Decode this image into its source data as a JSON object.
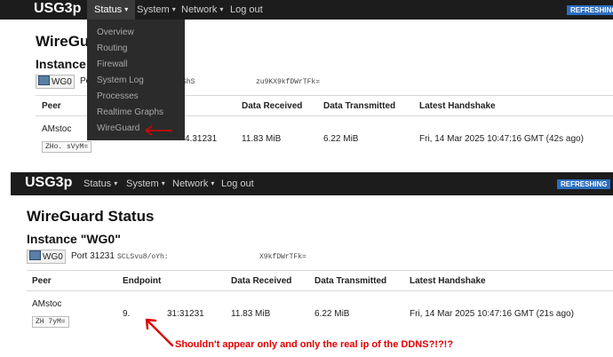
{
  "top_panel": {
    "brand": "USG3p",
    "nav": [
      "Status",
      "System",
      "Network",
      "Log out"
    ],
    "refresh_label": "REFRESHING",
    "dropdown_items": [
      "Overview",
      "Routing",
      "Firewall",
      "System Log",
      "Processes",
      "Realtime Graphs",
      "WireGuard"
    ],
    "page_title_partial": "WireGu",
    "instance_partial": "Instance \"",
    "interface_badge": "WG0",
    "port_partial": "Port",
    "key_partial_a": "ShS",
    "key_partial_b": "zu9KX9kfDWrTFk=",
    "headers": {
      "peer": "Peer",
      "data_received": "Data Received",
      "data_transmitted": "Data Transmitted",
      "latest_handshake": "Latest Handshake"
    },
    "row": {
      "peer_name": "AMstoc",
      "peer_key": "ZHo.    sVyM=",
      "endpoint_partial": "4.31231",
      "data_received": "11.83 MiB",
      "data_transmitted": "6.22 MiB",
      "latest_handshake": "Fri, 14 Mar 2025 10:47:16 GMT (42s ago)"
    }
  },
  "bottom_panel": {
    "brand": "USG3p",
    "nav": [
      "Status",
      "System",
      "Network",
      "Log out"
    ],
    "refresh_label": "REFRESHING",
    "page_title": "WireGuard Status",
    "instance_title": "Instance \"WG0\"",
    "interface_badge": "WG0",
    "port": "Port 31231",
    "key_partial_a": "SCLSvu8/oYh:",
    "key_partial_b": "X9kfDWrTFk=",
    "headers": {
      "peer": "Peer",
      "endpoint": "Endpoint",
      "data_received": "Data Received",
      "data_transmitted": "Data Transmitted",
      "latest_handshake": "Latest Handshake"
    },
    "row": {
      "peer_name": "AMstoc",
      "peer_key": "ZH       7yM=",
      "endpoint_a": "9.",
      "endpoint_b": "31:31231",
      "data_received": "11.83 MiB",
      "data_transmitted": "6.22 MiB",
      "latest_handshake": "Fri, 14 Mar 2025 10:47:16 GMT (21s ago)"
    }
  },
  "annotation": "Shouldn't appear only and only the real ip of the DDNS?!?!?",
  "colors": {
    "annotation": "#e00000",
    "navbar": "#1c1c1c",
    "refresh": "#2a6ebf"
  }
}
